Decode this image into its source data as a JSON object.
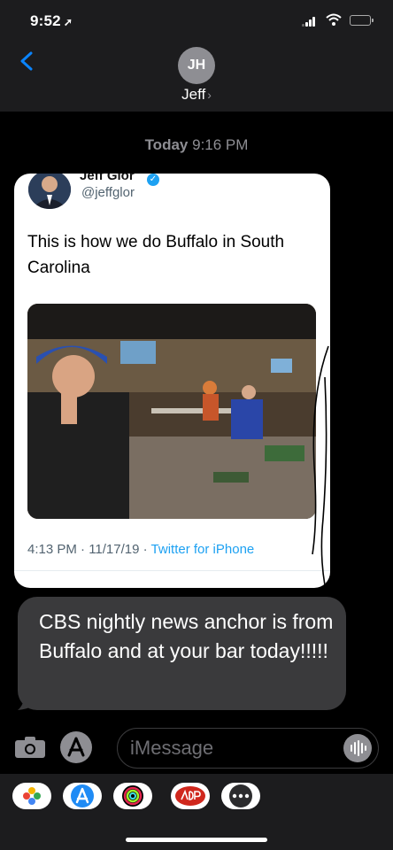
{
  "status_bar": {
    "time": "9:52",
    "location_icon": "location-arrow-icon",
    "signal_icon": "cellular-signal-icon",
    "wifi_icon": "wifi-icon",
    "battery_icon": "battery-icon"
  },
  "header": {
    "back_icon": "chevron-left-icon",
    "avatar_initials": "JH",
    "contact_name": "Jeff",
    "contact_chevron": "›"
  },
  "thread": {
    "date_label": "Today",
    "date_time": "9:16 PM",
    "tweet": {
      "author_name": "Jeff Glor",
      "handle": "@jeffglor",
      "text": "This is how we do Buffalo in South Carolina",
      "meta_time": "4:13 PM · 11/17/19 · ",
      "meta_source": "Twitter for iPhone"
    },
    "message": {
      "text": "CBS nightly news anchor is from Buffalo and at your bar today!!!!!"
    }
  },
  "composer": {
    "placeholder": "iMessage"
  },
  "colors": {
    "bubble": "#3a3a3c",
    "header": "#1c1c1e",
    "link": "#1da1f2",
    "meta_gray": "#536471"
  }
}
